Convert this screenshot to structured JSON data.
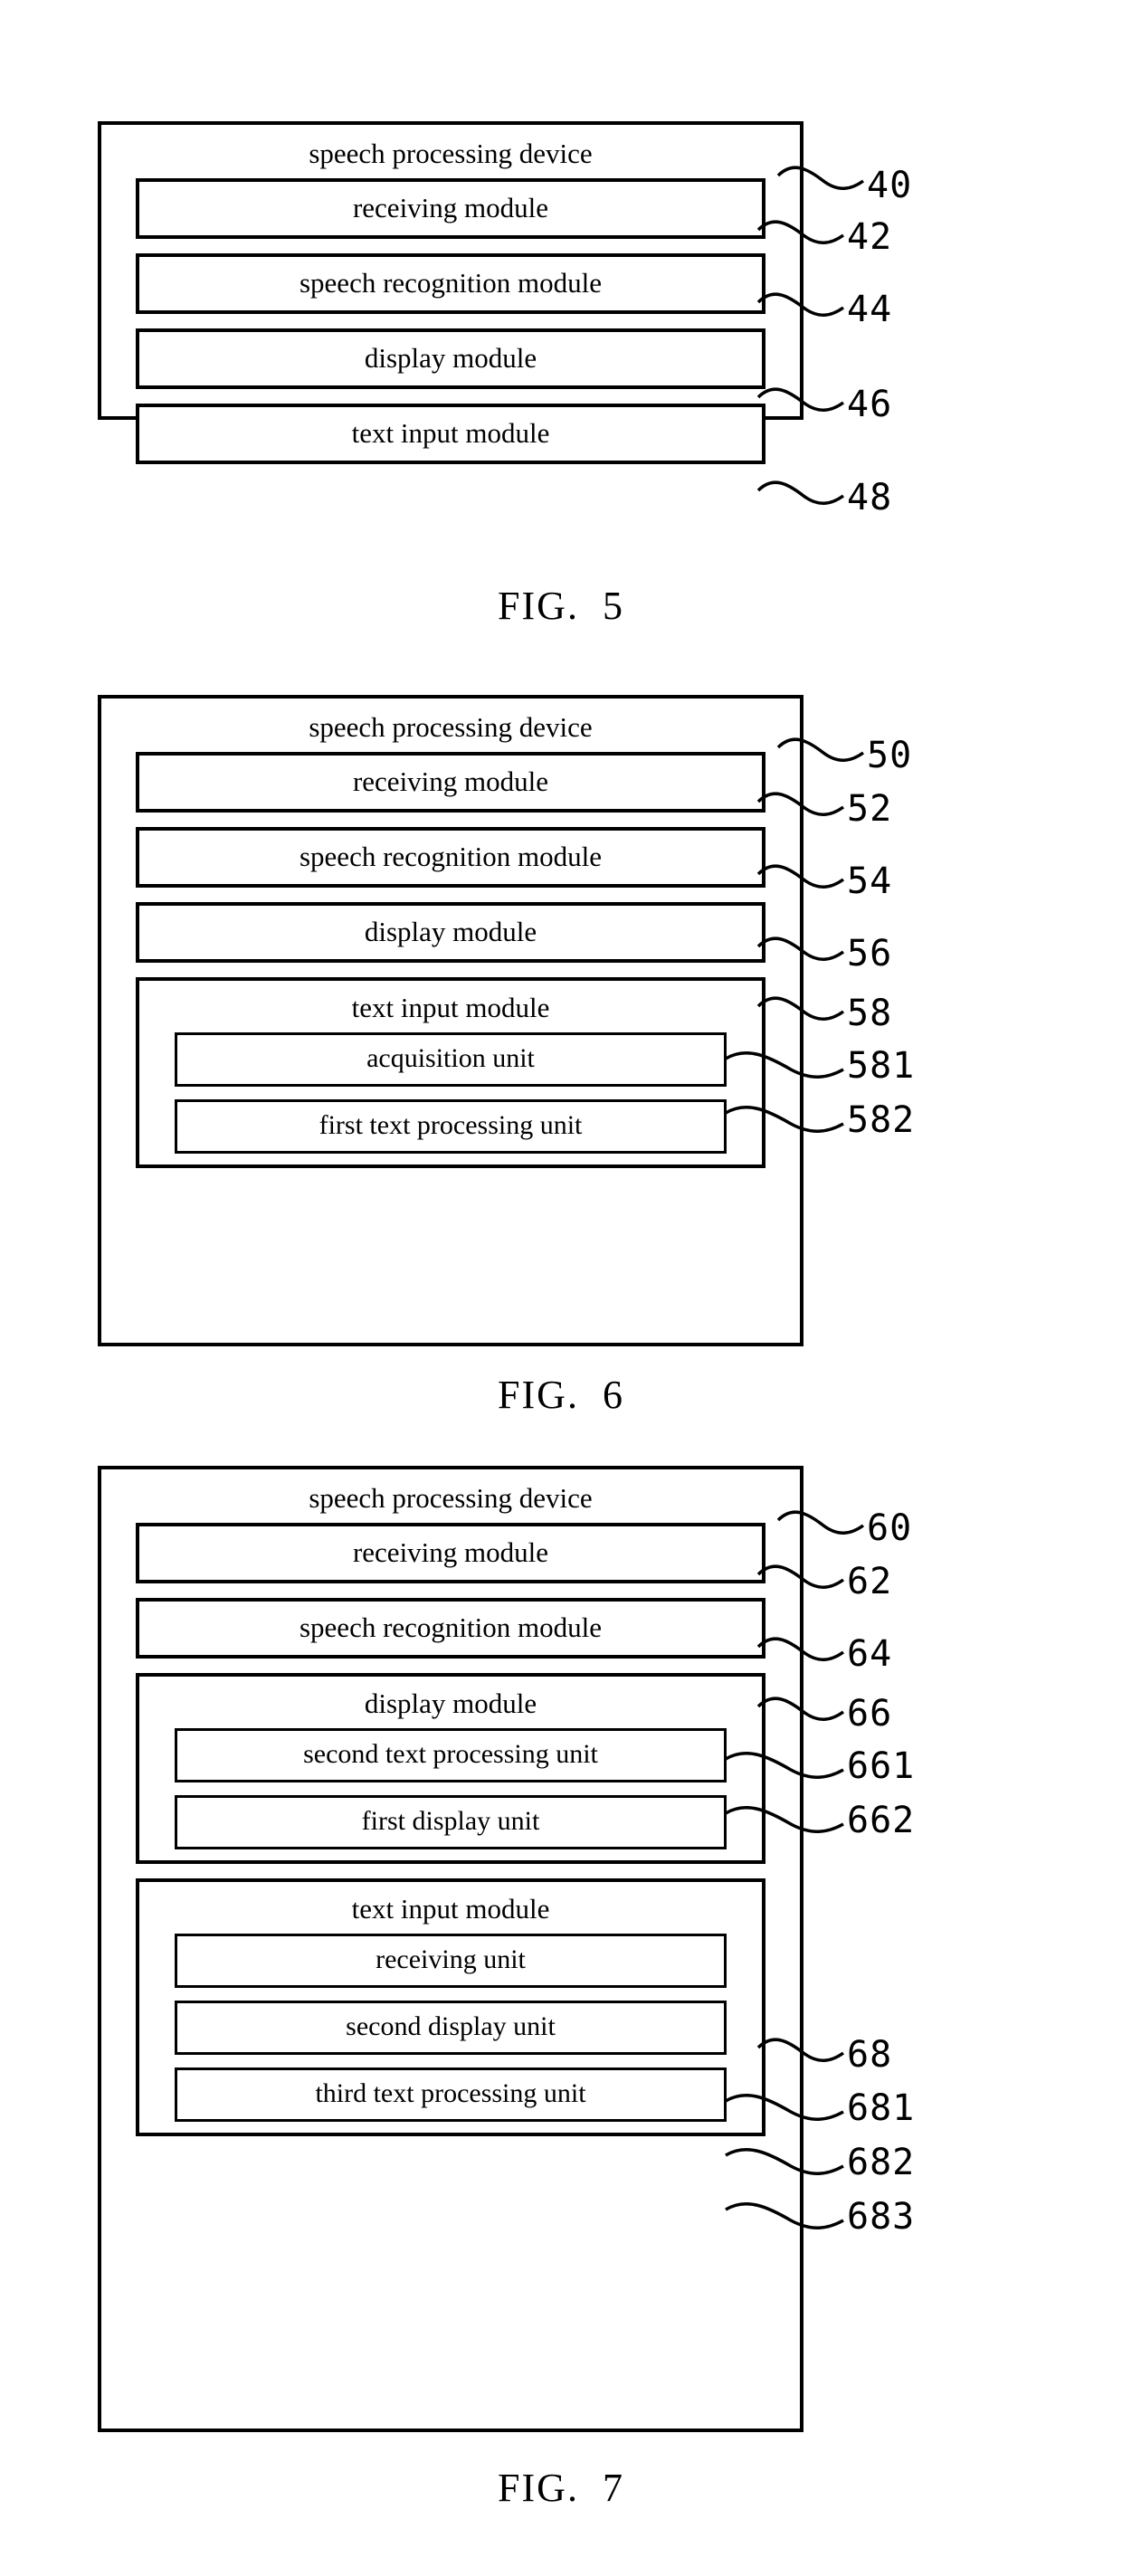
{
  "document": {
    "type": "patent-drawing-sheet",
    "figures": [
      {
        "caption": "FIG.  5",
        "device_label": "speech processing device",
        "device_ref": "40",
        "modules": [
          {
            "label": "receiving module",
            "ref": "42"
          },
          {
            "label": "speech recognition module",
            "ref": "44"
          },
          {
            "label": "display module",
            "ref": "46"
          },
          {
            "label": "text input module",
            "ref": "48"
          }
        ]
      },
      {
        "caption": "FIG.  6",
        "device_label": "speech processing device",
        "device_ref": "50",
        "modules": [
          {
            "label": "receiving module",
            "ref": "52"
          },
          {
            "label": "speech recognition module",
            "ref": "54"
          },
          {
            "label": "display module",
            "ref": "56"
          },
          {
            "label": "text input module",
            "ref": "58",
            "units": [
              {
                "label": "acquisition unit",
                "ref": "581"
              },
              {
                "label": "first text processing unit",
                "ref": "582"
              }
            ]
          }
        ]
      },
      {
        "caption": "FIG.  7",
        "device_label": "speech processing device",
        "device_ref": "60",
        "modules": [
          {
            "label": "receiving module",
            "ref": "62"
          },
          {
            "label": "speech recognition module",
            "ref": "64"
          },
          {
            "label": "display module",
            "ref": "66",
            "units": [
              {
                "label": "second text processing unit",
                "ref": "661"
              },
              {
                "label": "first display unit",
                "ref": "662"
              }
            ]
          },
          {
            "label": "text input module",
            "ref": "68",
            "units": [
              {
                "label": "receiving unit",
                "ref": "681"
              },
              {
                "label": "second display unit",
                "ref": "682"
              },
              {
                "label": "third text processing unit",
                "ref": "683"
              }
            ]
          }
        ]
      }
    ],
    "colors": {
      "ink": "#000000",
      "paper": "#ffffff"
    }
  }
}
